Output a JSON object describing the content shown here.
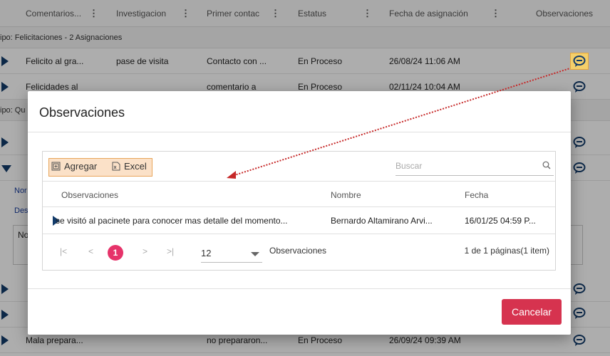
{
  "grid": {
    "headers": [
      "Comentarios...",
      "Investigacion",
      "Primer contac",
      "Estatus",
      "Fecha de asignación",
      "Observaciones"
    ],
    "groups": [
      {
        "label": "ipo: Felicitaciones - 2 Asignaciones"
      },
      {
        "label": "ipo: Qu"
      }
    ],
    "rows": [
      {
        "comentarios": "Felicito al gra...",
        "investigacion": "pase de visita",
        "primer_contacto": "Contacto con ...",
        "estatus": "En Proceso",
        "fecha": "26/08/24 11:06 AM"
      },
      {
        "comentarios": "Felicidades al",
        "investigacion": "",
        "primer_contacto": "comentario a",
        "estatus": "En Proceso",
        "fecha": "02/11/24 10:04 AM"
      },
      {
        "comentarios": "",
        "investigacion": "",
        "primer_contacto": "",
        "estatus": "",
        "fecha": ""
      },
      {
        "comentarios": "",
        "investigacion": "",
        "primer_contacto": "",
        "estatus": "",
        "fecha": ""
      },
      {
        "comentarios": "",
        "investigacion": "",
        "primer_contacto": "",
        "estatus": "",
        "fecha": ""
      },
      {
        "comentarios": "",
        "investigacion": "",
        "primer_contacto": "",
        "estatus": "",
        "fecha": ""
      },
      {
        "comentarios": "Mala prepara...",
        "investigacion": "",
        "primer_contacto": "no prepararon...",
        "estatus": "En Proceso",
        "fecha": "26/09/24 09:39 AM"
      }
    ],
    "detail": {
      "label1": "Nor",
      "label2": "Des",
      "box_text": "No"
    }
  },
  "modal": {
    "title": "Observaciones",
    "toolbar": {
      "add_label": "Agregar",
      "excel_label": "Excel",
      "search_placeholder": "Buscar"
    },
    "columns": [
      "Observaciones",
      "Nombre",
      "Fecha"
    ],
    "rows": [
      {
        "observacion": "se visitó al pacinete para conocer mas detalle del momento...",
        "nombre": "Bernardo Altamirano Arvi...",
        "fecha": "16/01/25 04:59 P..."
      }
    ],
    "pager": {
      "first": "|<",
      "prev": "<",
      "current": "1",
      "next": ">",
      "last": ">|",
      "page_size": "12",
      "label": "Observaciones",
      "info": "1 de 1 páginas(1 item)"
    },
    "cancel_label": "Cancelar"
  },
  "colors": {
    "accent_pink": "#e6336a",
    "cancel_red": "#d6334f",
    "arrow_red": "#c62828",
    "highlight_yellow": "#f4cf6a",
    "highlight_orange": "#fbe1c8",
    "row_marker_navy": "#123b6b"
  }
}
